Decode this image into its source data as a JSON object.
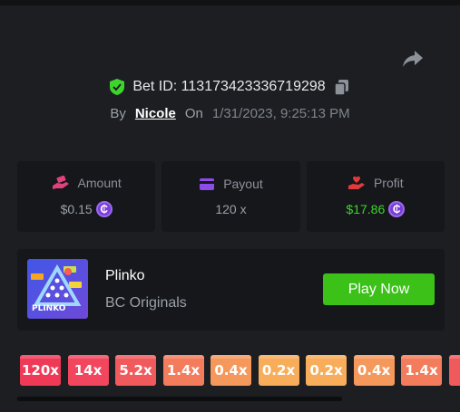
{
  "bet": {
    "id_label": "Bet ID: 113173423336719298",
    "by_label": "By",
    "username": "Nicole",
    "on_label": "On",
    "datetime": "1/31/2023, 9:25:13 PM"
  },
  "stats": {
    "amount": {
      "label": "Amount",
      "value": "$0.15",
      "icon": "hand-coin-icon",
      "icon_color": "#e0427a"
    },
    "payout": {
      "label": "Payout",
      "value": "120 x",
      "icon": "wallet-icon",
      "icon_color": "#8d4be8"
    },
    "profit": {
      "label": "Profit",
      "value": "$17.86",
      "icon": "hand-heart-icon",
      "icon_color": "#e03a3a",
      "value_color": "#3dd52b"
    }
  },
  "game": {
    "title": "Plinko",
    "provider": "BC Originals",
    "thumb_label": "PLINKO",
    "play_label": "Play Now"
  },
  "multipliers": [
    {
      "label": "120x",
      "color": "#ef3a57"
    },
    {
      "label": "14x",
      "color": "#f1465d"
    },
    {
      "label": "5.2x",
      "color": "#f15a5d"
    },
    {
      "label": "1.4x",
      "color": "#f37c5c"
    },
    {
      "label": "0.4x",
      "color": "#f5985c"
    },
    {
      "label": "0.2x",
      "color": "#f7ad5a"
    },
    {
      "label": "0.2x",
      "color": "#f7ad5a"
    },
    {
      "label": "0.4x",
      "color": "#f5985c"
    },
    {
      "label": "1.4x",
      "color": "#f37c5c"
    },
    {
      "label": "",
      "color": "#f15a5d"
    }
  ],
  "coin_symbol": "₵",
  "colors": {
    "background": "#1c1e22",
    "card": "#15171a",
    "accent_green": "#3bc117",
    "coin_purple": "#7a3dd9"
  }
}
